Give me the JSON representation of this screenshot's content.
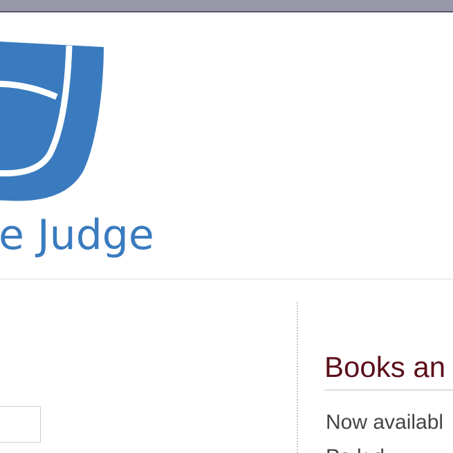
{
  "header": {
    "logo_text": "e Judge"
  },
  "sidebar": {
    "heading": "Books an",
    "line1": "Now availabl",
    "line2": "Pa   k   d"
  },
  "colors": {
    "titlebar": "#9898a8",
    "logo_blue": "#3a7bbf",
    "heading": "#5b0f1a",
    "body_text": "#444444"
  }
}
